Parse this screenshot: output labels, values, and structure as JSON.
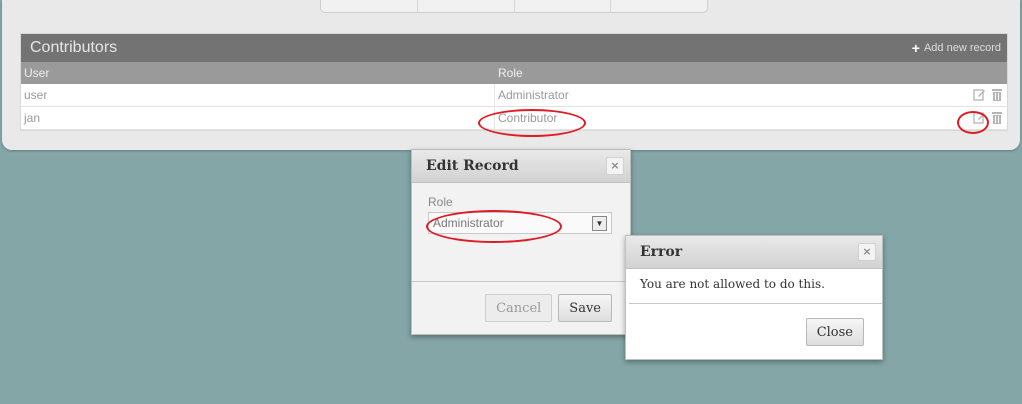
{
  "grid": {
    "title": "Contributors",
    "add_label": "Add new record",
    "columns": {
      "user": "User",
      "role": "Role"
    },
    "rows": [
      {
        "user": "user",
        "role": "Administrator"
      },
      {
        "user": "jan",
        "role": "Contributor"
      }
    ]
  },
  "edit_dialog": {
    "title": "Edit Record",
    "close": "×",
    "field_label": "Role",
    "selected_role": "Administrator",
    "cancel": "Cancel",
    "save": "Save"
  },
  "error_dialog": {
    "title": "Error",
    "close": "×",
    "message": "You are not allowed to do this.",
    "close_button": "Close"
  },
  "colors": {
    "background": "#84a6a6",
    "header": "#737373",
    "annotation": "#e01b24"
  }
}
